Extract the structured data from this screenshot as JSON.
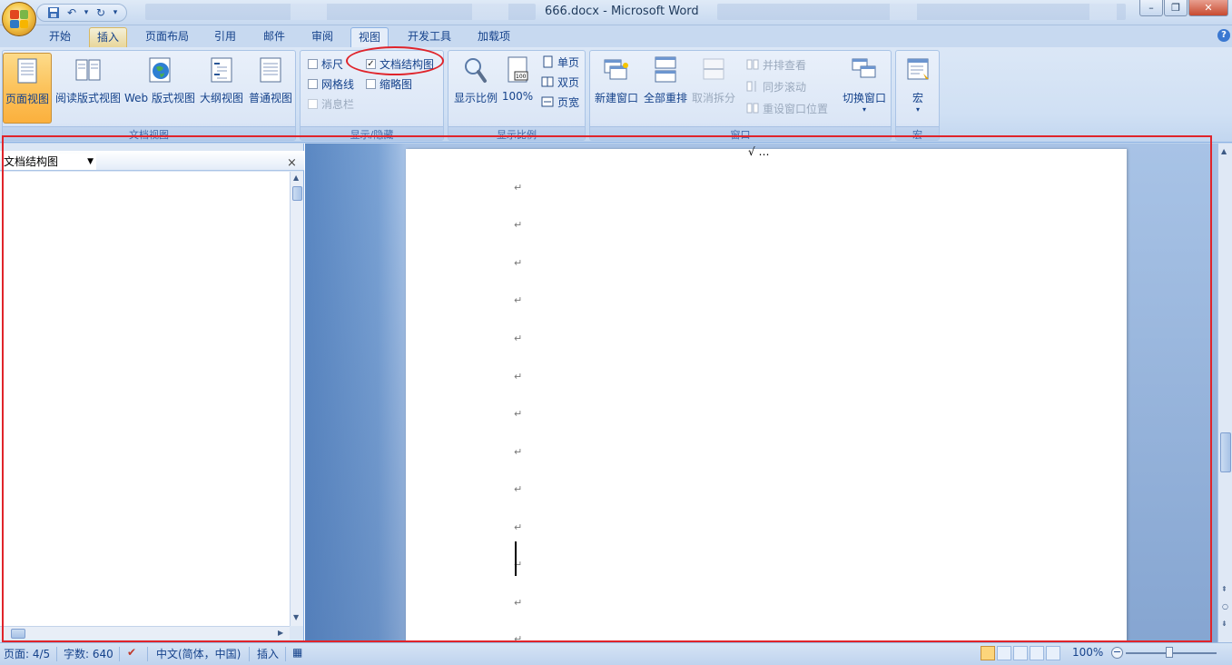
{
  "window": {
    "title": "666.docx - Microsoft Word"
  },
  "tabs": [
    "开始",
    "插入",
    "页面布局",
    "引用",
    "邮件",
    "审阅",
    "视图",
    "开发工具",
    "加载项"
  ],
  "active_tab": "视图",
  "ribbon": {
    "doc_views": {
      "label": "文档视图",
      "buttons": [
        "页面视图",
        "阅读版式视图",
        "Web 版式视图",
        "大纲视图",
        "普通视图"
      ]
    },
    "show_hide": {
      "label": "显示/隐藏",
      "ruler": "标尺",
      "gridlines": "网格线",
      "message_bar": "消息栏",
      "doc_map": "文档结构图",
      "thumbnails": "缩略图"
    },
    "zoom": {
      "label": "显示比例",
      "zoom_btn": "显示比例",
      "hundred": "100%",
      "hundred_icon_text": "100",
      "one_page": "单页",
      "two_pages": "双页",
      "page_width": "页宽"
    },
    "window": {
      "label": "窗口",
      "new_window": "新建窗口",
      "arrange_all": "全部重排",
      "split": "取消拆分",
      "side_by_side": "并排查看",
      "sync_scroll": "同步滚动",
      "reset_pos": "重设窗口位置",
      "switch": "切换窗口"
    },
    "macros": {
      "label": "宏",
      "macros": "宏"
    }
  },
  "nav_pane": {
    "dropdown_value": "文档结构图",
    "close": "×"
  },
  "document": {
    "top_text": "√ …",
    "para_mark": "↵"
  },
  "status": {
    "page": "页面: 4/5",
    "words": "字数: 640",
    "language": "中文(简体，中国)",
    "mode": "插入",
    "zoom": "100%"
  },
  "colors": {
    "annotation": "#e0242b",
    "accent": "#15428b"
  }
}
